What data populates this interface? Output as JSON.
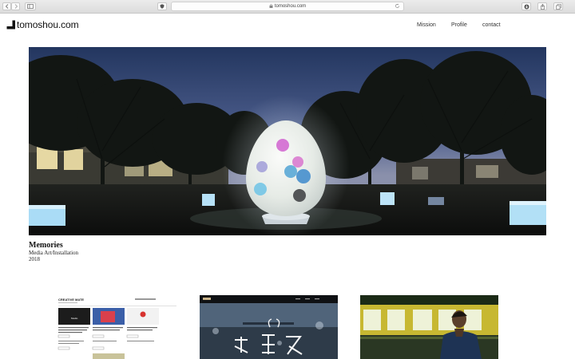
{
  "browser": {
    "url": "tomoshou.com",
    "icons": [
      "back-icon",
      "forward-icon",
      "sidebar-icon",
      "shield-icon",
      "lock-icon",
      "reload-icon",
      "download-icon",
      "share-icon",
      "tabs-icon"
    ]
  },
  "site": {
    "logo_text": "tomoshou.com",
    "nav": [
      "Mission",
      "Profile",
      "contact"
    ]
  },
  "featured": {
    "title": "Memories",
    "category": "Media Art/Installation",
    "year": "2018"
  },
  "thumbnails": {
    "first": {
      "brand": "CREATIVE MATE"
    }
  },
  "colors": {
    "sky_top": "#2c3f6d",
    "sky_horizon": "#7d86a3",
    "egg_glow": "#f1f3f6",
    "light_cube": "#a9dcf5"
  }
}
